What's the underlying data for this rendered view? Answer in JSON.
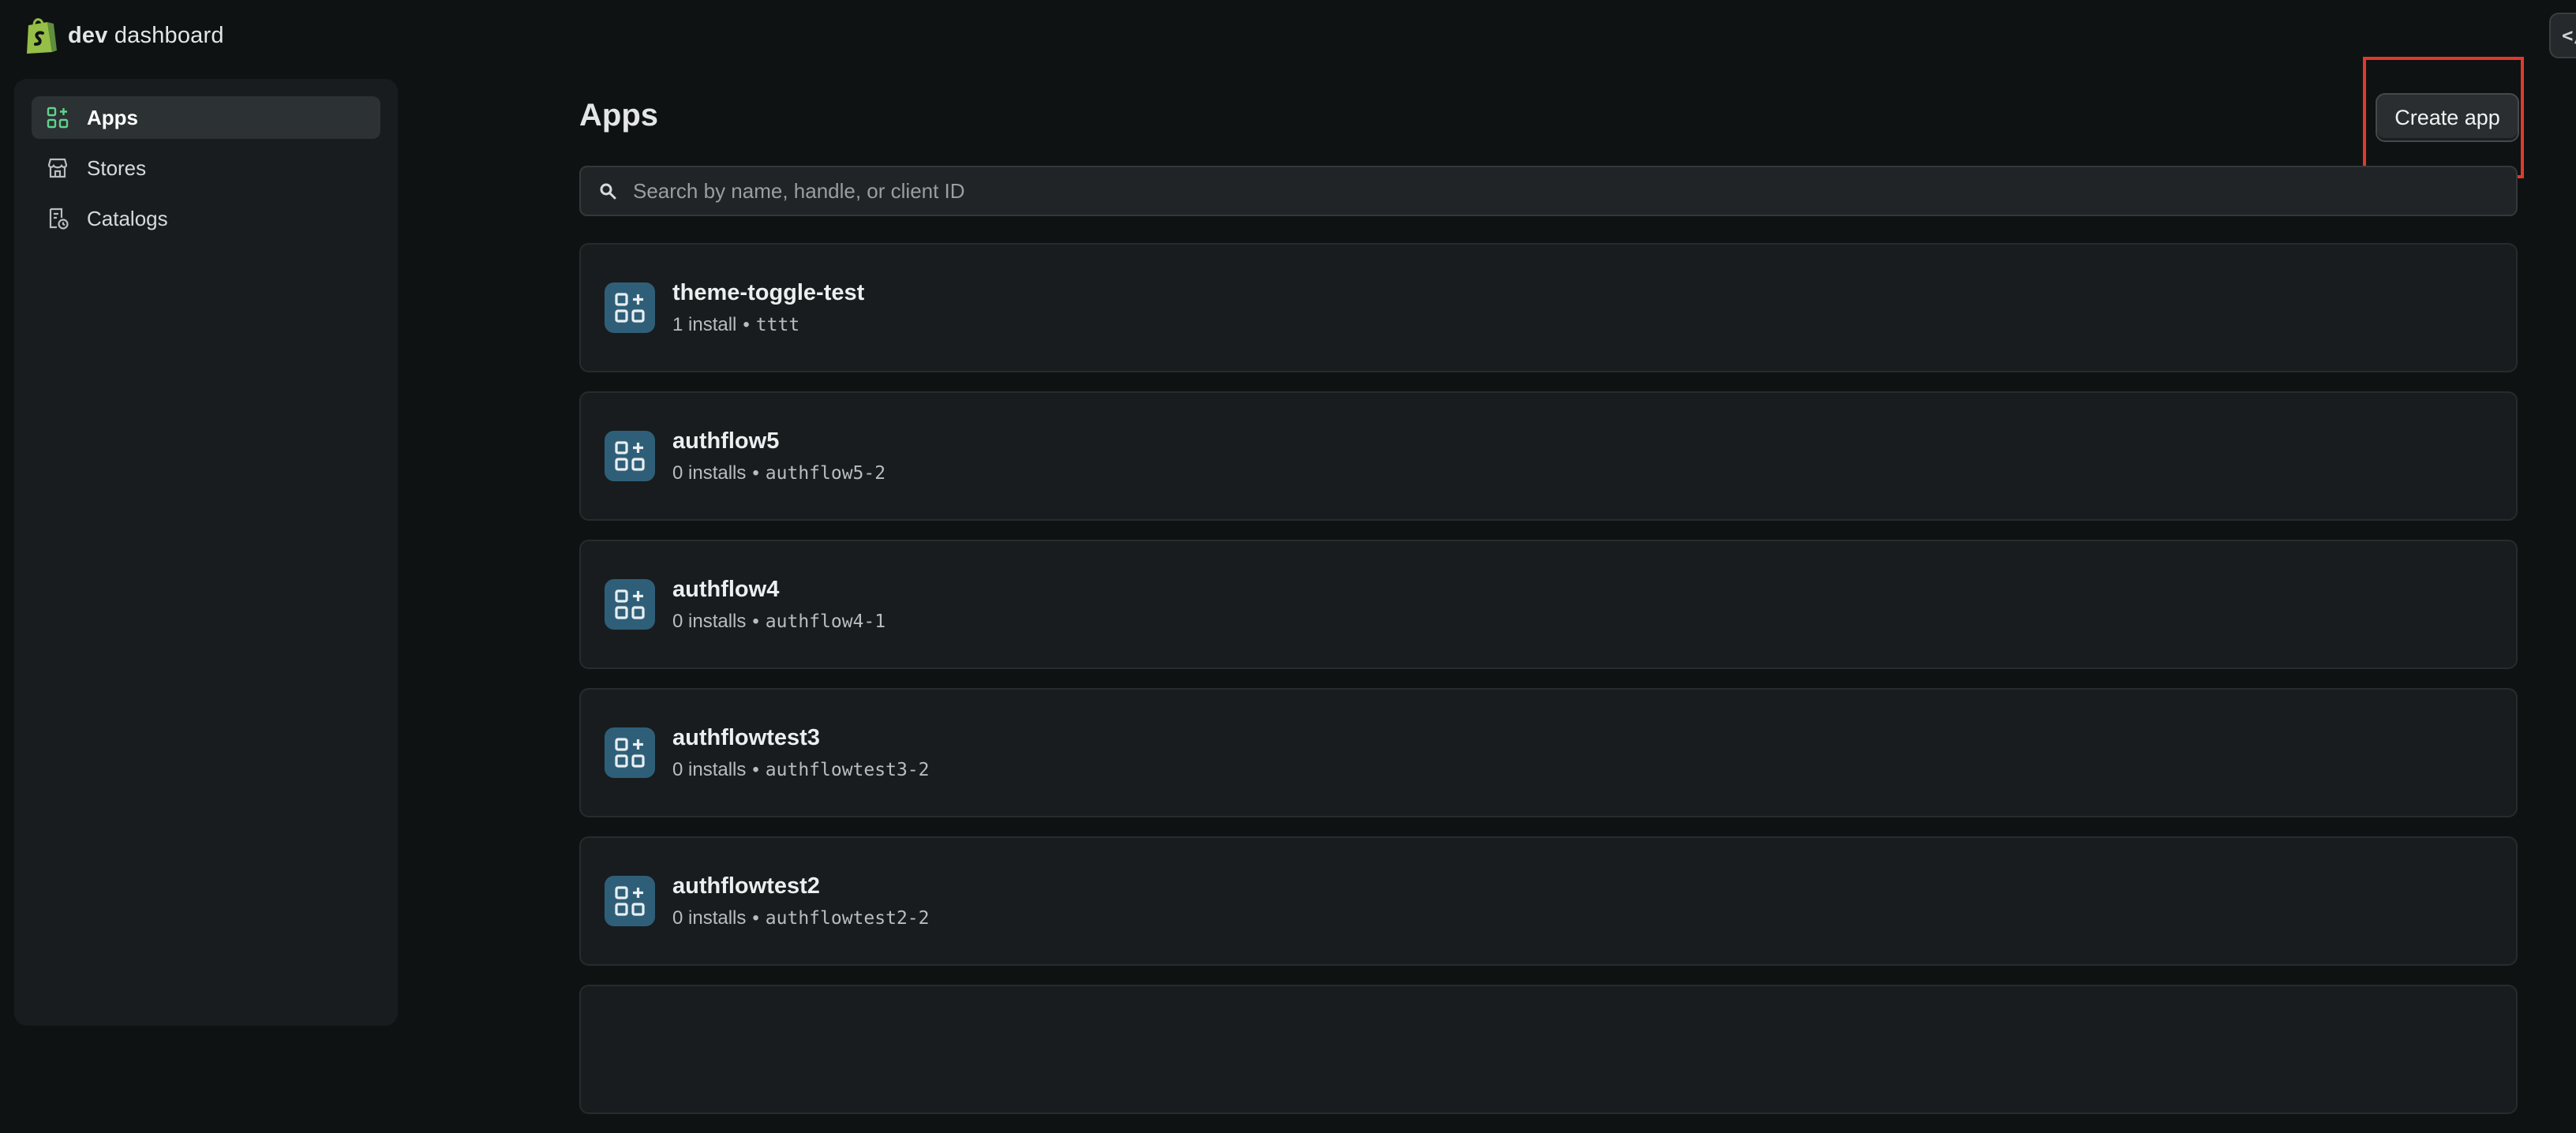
{
  "header": {
    "brand_bold": "dev",
    "brand_rest": "dashboard",
    "code_toggle_label": "</"
  },
  "sidebar": {
    "items": [
      {
        "label": "Apps",
        "icon": "apps-icon",
        "active": true
      },
      {
        "label": "Stores",
        "icon": "store-icon",
        "active": false
      },
      {
        "label": "Catalogs",
        "icon": "catalog-icon",
        "active": false
      }
    ]
  },
  "main": {
    "title": "Apps",
    "create_label": "Create app",
    "search_placeholder": "Search by name, handle, or client ID",
    "apps": [
      {
        "name": "theme-toggle-test",
        "installs": "1 install",
        "handle": "tttt"
      },
      {
        "name": "authflow5",
        "installs": "0 installs",
        "handle": "authflow5-2"
      },
      {
        "name": "authflow4",
        "installs": "0 installs",
        "handle": "authflow4-1"
      },
      {
        "name": "authflowtest3",
        "installs": "0 installs",
        "handle": "authflowtest3-2"
      },
      {
        "name": "authflowtest2",
        "installs": "0 installs",
        "handle": "authflowtest2-2"
      }
    ]
  },
  "colors": {
    "background": "#0f1213",
    "sidebar": "#181c1e",
    "accent_green": "#5fd38b",
    "app_icon_bg": "#2f5f78",
    "highlight_red": "#e03a2c"
  }
}
